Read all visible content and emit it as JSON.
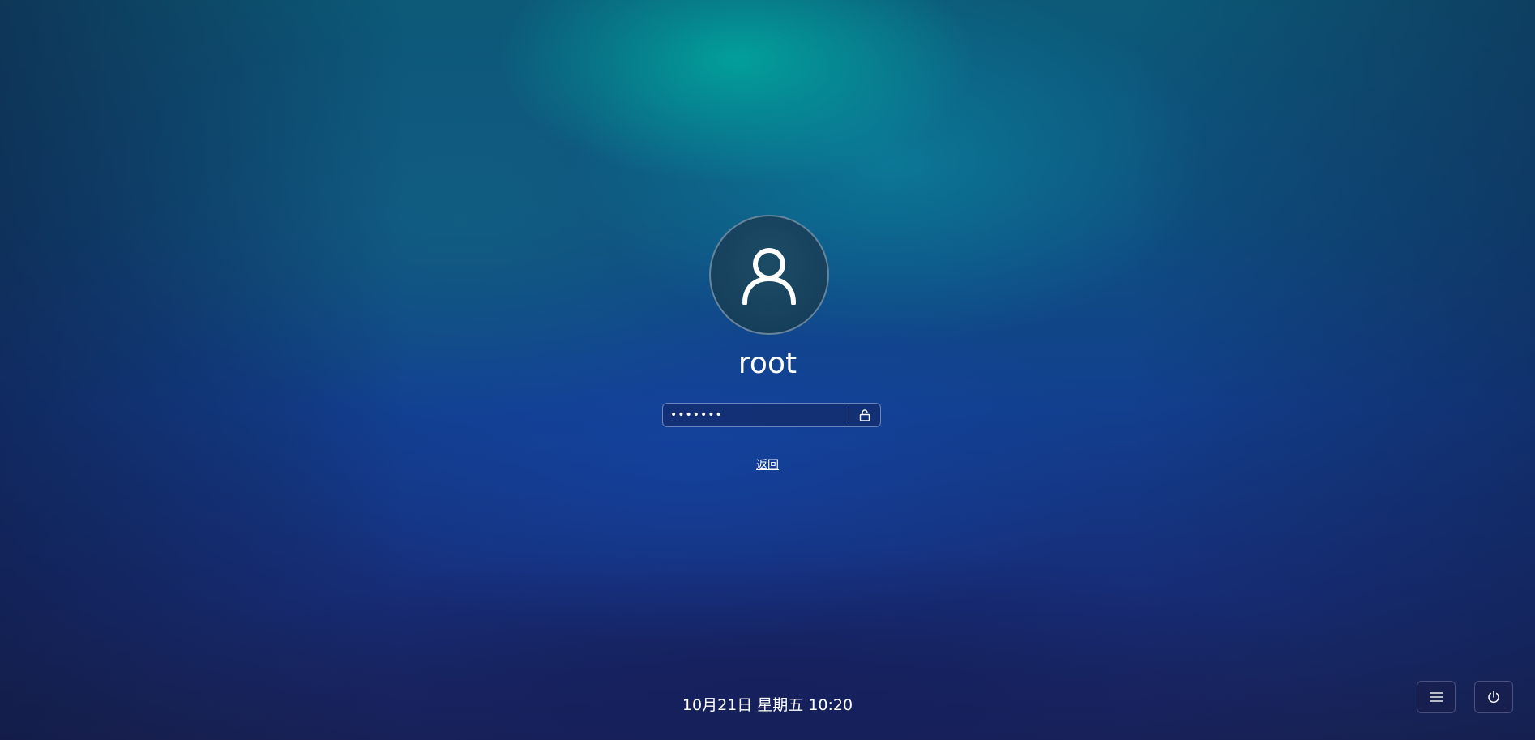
{
  "login": {
    "username": "root",
    "password_masked": "•••••••",
    "back_label": "返回"
  },
  "footer": {
    "datetime": "10月21日 星期五 10:20"
  },
  "icons": {
    "avatar": "user-icon",
    "lock": "unlock-icon",
    "menu": "hamburger-menu-icon",
    "power": "power-icon"
  },
  "colors": {
    "text": "#ffffff",
    "wallpaper_top": "#0c5a78",
    "wallpaper_bottom": "#1a2258"
  }
}
